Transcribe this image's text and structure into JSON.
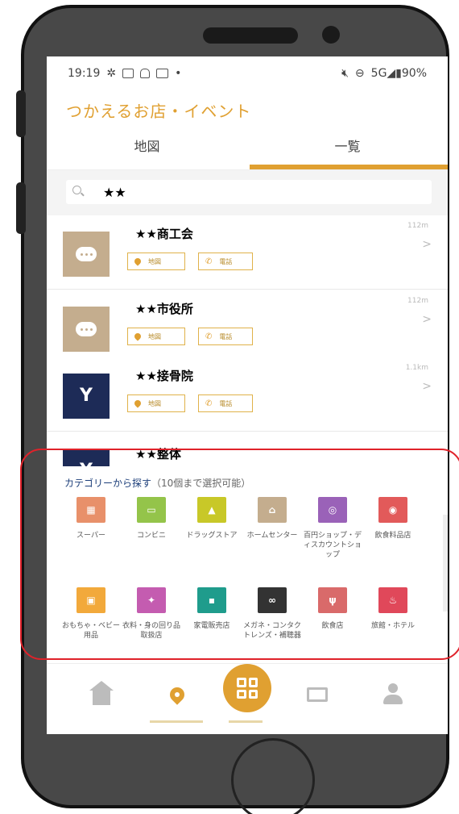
{
  "status_bar": {
    "time": "19:19",
    "right": "5G◢▮90%"
  },
  "app": {
    "title": "つかえるお店・イベント"
  },
  "tabs": [
    {
      "label": "地図",
      "active": false
    },
    {
      "label": "一覧",
      "active": true
    }
  ],
  "search": {
    "value": "★★"
  },
  "list": {
    "items": [
      {
        "name": "★★商工会",
        "distance": "112m",
        "icon": "chat-bubble-icon",
        "map_label": "地図",
        "tel_label": "電話"
      },
      {
        "name": "★★市役所",
        "distance": "112m",
        "icon": "chat-bubble-icon",
        "map_label": "地図",
        "tel_label": "電話"
      },
      {
        "name": "★★接骨院",
        "distance": "1.1km",
        "icon": "cocktail-glass-icon",
        "map_label": "地図",
        "tel_label": "電話"
      },
      {
        "name": "★★整体",
        "icon": "cocktail-glass-icon"
      }
    ]
  },
  "categories": {
    "title": "カテゴリーから探す",
    "subtitle": "（10個まで選択可能）",
    "items": [
      {
        "label": "スーパー",
        "color": "#e8906a",
        "icon": "supermarket-icon"
      },
      {
        "label": "コンビニ",
        "color": "#94c44a",
        "icon": "convenience-store-icon"
      },
      {
        "label": "ドラッグストア",
        "color": "#c8c828",
        "icon": "drugstore-icon"
      },
      {
        "label": "ホームセンター",
        "color": "#c4ad8e",
        "icon": "home-center-icon"
      },
      {
        "label": "百円ショップ・ディスカウントショップ",
        "color": "#9a62b8",
        "icon": "hundred-yen-shop-icon"
      },
      {
        "label": "飲食料品店",
        "color": "#e25a5a",
        "icon": "food-store-icon"
      },
      {
        "label": "おもちゃ・ベビー用品",
        "color": "#f2a93b",
        "icon": "toy-baby-icon"
      },
      {
        "label": "衣料・身の回り品取扱店",
        "color": "#c45cb0",
        "icon": "clothing-icon"
      },
      {
        "label": "家電販売店",
        "color": "#1f9c8c",
        "icon": "appliance-icon"
      },
      {
        "label": "メガネ・コンタクトレンズ・補聴器",
        "color": "#333333",
        "icon": "glasses-icon"
      },
      {
        "label": "飲食店",
        "color": "#d96a6a",
        "icon": "restaurant-icon"
      },
      {
        "label": "旅館・ホテル",
        "color": "#e0485a",
        "icon": "hotel-icon"
      }
    ]
  },
  "colors": {
    "accent": "#e0a031",
    "highlight": "#e0222a",
    "navy": "#1d2b57"
  }
}
